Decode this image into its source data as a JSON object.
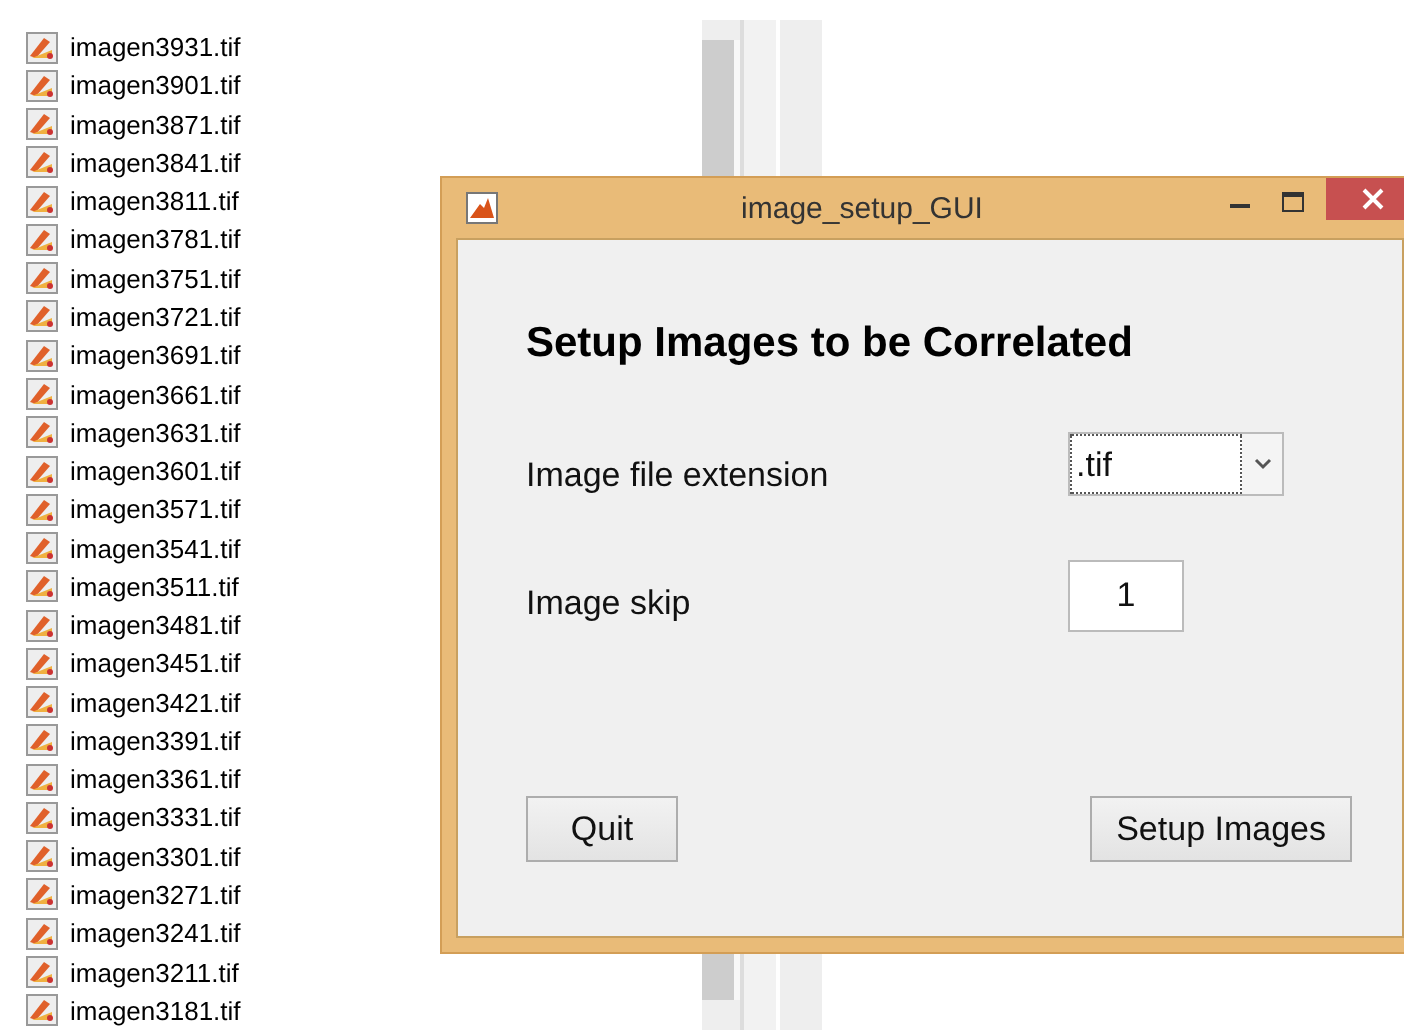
{
  "files": [
    "imagen3931.tif",
    "imagen3901.tif",
    "imagen3871.tif",
    "imagen3841.tif",
    "imagen3811.tif",
    "imagen3781.tif",
    "imagen3751.tif",
    "imagen3721.tif",
    "imagen3691.tif",
    "imagen3661.tif",
    "imagen3631.tif",
    "imagen3601.tif",
    "imagen3571.tif",
    "imagen3541.tif",
    "imagen3511.tif",
    "imagen3481.tif",
    "imagen3451.tif",
    "imagen3421.tif",
    "imagen3391.tif",
    "imagen3361.tif",
    "imagen3331.tif",
    "imagen3301.tif",
    "imagen3271.tif",
    "imagen3241.tif",
    "imagen3211.tif",
    "imagen3181.tif"
  ],
  "window": {
    "title": "image_setup_GUI"
  },
  "heading": "Setup Images to be Correlated",
  "extension": {
    "label": "Image file extension",
    "value": ".tif"
  },
  "skip": {
    "label": "Image skip",
    "value": "1"
  },
  "buttons": [
    "Quit",
    "Setup Images"
  ]
}
